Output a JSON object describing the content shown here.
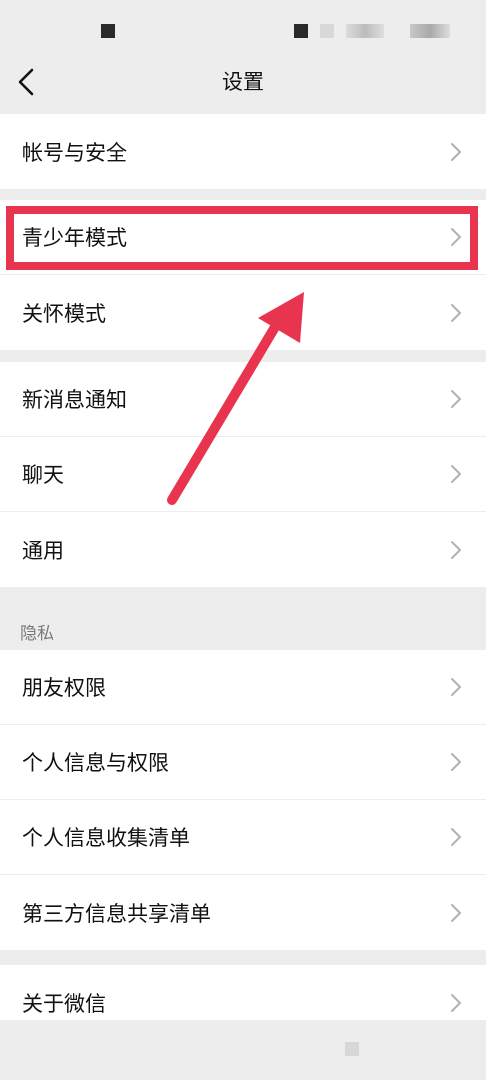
{
  "header": {
    "title": "设置",
    "back_icon": "chevron-left-icon"
  },
  "groups": [
    {
      "items": [
        {
          "label": "帐号与安全"
        }
      ]
    },
    {
      "items": [
        {
          "label": "青少年模式"
        },
        {
          "label": "关怀模式"
        }
      ]
    },
    {
      "items": [
        {
          "label": "新消息通知"
        },
        {
          "label": "聊天"
        },
        {
          "label": "通用"
        }
      ]
    },
    {
      "section_label": "隐私",
      "items": [
        {
          "label": "朋友权限"
        },
        {
          "label": "个人信息与权限"
        },
        {
          "label": "个人信息收集清单"
        },
        {
          "label": "第三方信息共享清单"
        }
      ]
    },
    {
      "items": [
        {
          "label": "关于微信"
        }
      ]
    }
  ],
  "annotation": {
    "highlight_color": "#e8344e",
    "highlighted_item": "青少年模式"
  },
  "colors": {
    "background": "#ededed",
    "card": "#ffffff",
    "text": "#111111",
    "section_label": "#7a7a7a",
    "chevron": "#b2b2b2"
  }
}
